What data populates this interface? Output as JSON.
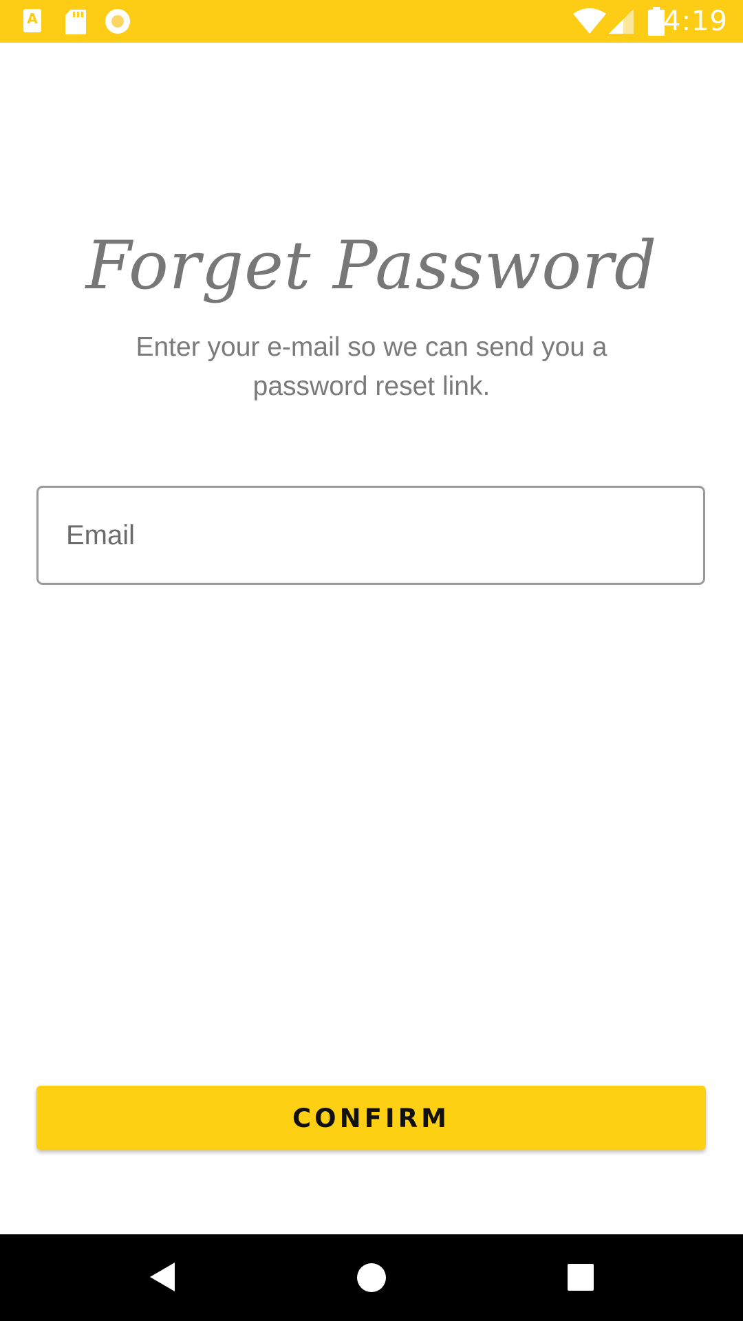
{
  "status_bar": {
    "time": "4:19",
    "icons": [
      "a-notification-icon",
      "sd-card-icon",
      "circle-notification-icon",
      "wifi-icon",
      "cell-signal-icon",
      "battery-icon"
    ],
    "background_color": "#fdcd15"
  },
  "header": {
    "title": "Forget Password",
    "subtitle": "Enter your e-mail so we can send you a password reset link."
  },
  "form": {
    "email": {
      "placeholder": "Email",
      "value": ""
    }
  },
  "actions": {
    "confirm_label": "CONFIRM",
    "accent_color": "#fdd013"
  },
  "nav_bar": {
    "buttons": [
      "back-icon",
      "home-icon",
      "recents-icon"
    ]
  }
}
